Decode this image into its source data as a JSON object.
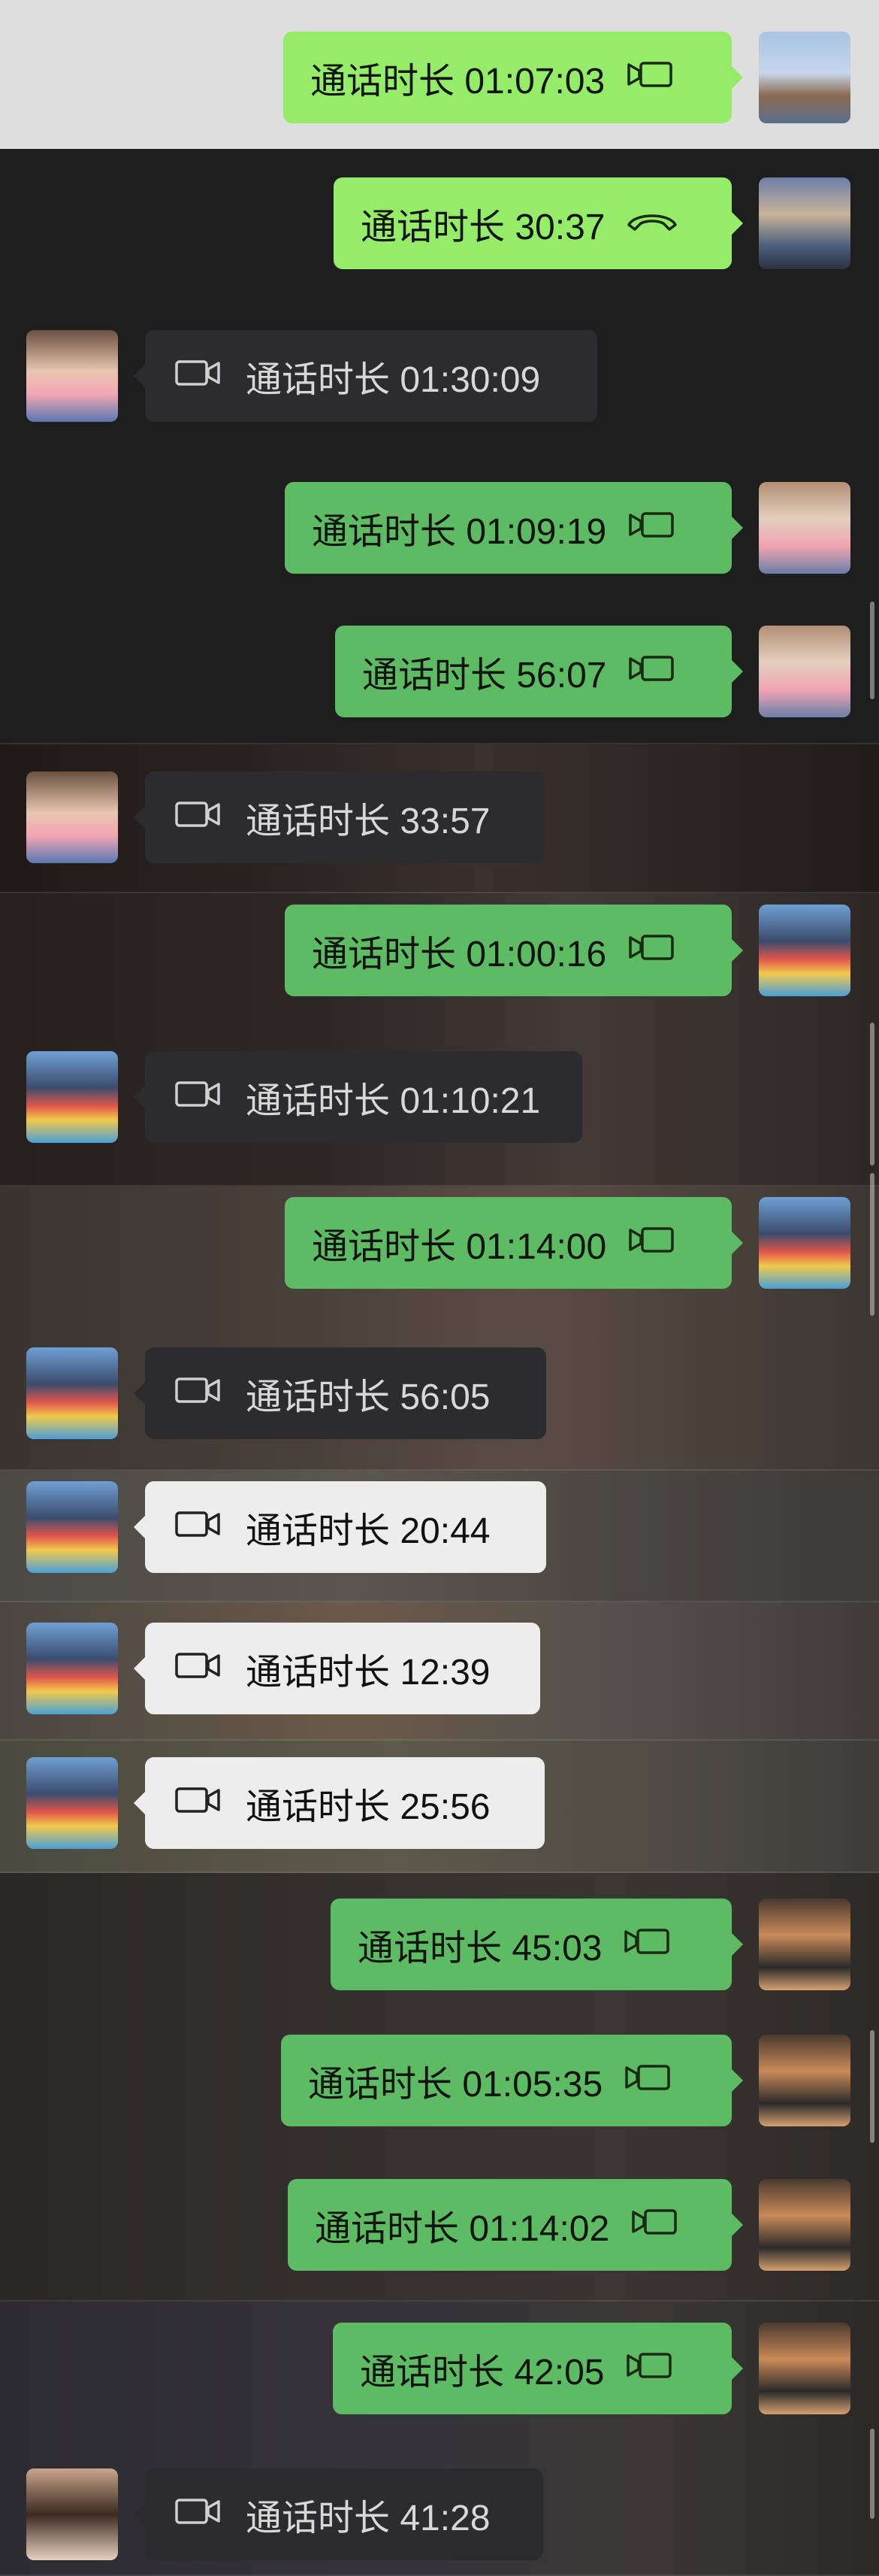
{
  "call_prefix": "通话时长",
  "messages": [
    {
      "side": "sent",
      "duration": "01:07:03",
      "icon": "video-call-icon",
      "style": "light"
    },
    {
      "side": "sent",
      "duration": "30:37",
      "icon": "voice-call-icon",
      "style": "light"
    },
    {
      "side": "received",
      "duration": "01:30:09",
      "icon": "video-call-icon",
      "style": "dark"
    },
    {
      "side": "sent",
      "duration": "01:09:19",
      "icon": "video-call-icon",
      "style": "dark"
    },
    {
      "side": "sent",
      "duration": "56:07",
      "icon": "video-call-icon",
      "style": "dark"
    },
    {
      "side": "received",
      "duration": "33:57",
      "icon": "video-call-icon",
      "style": "dark"
    },
    {
      "side": "sent",
      "duration": "01:00:16",
      "icon": "video-call-icon",
      "style": "dark"
    },
    {
      "side": "received",
      "duration": "01:10:21",
      "icon": "video-call-icon",
      "style": "dark"
    },
    {
      "side": "sent",
      "duration": "01:14:00",
      "icon": "video-call-icon",
      "style": "dark"
    },
    {
      "side": "received",
      "duration": "56:05",
      "icon": "video-call-icon",
      "style": "dark"
    },
    {
      "side": "received",
      "duration": "20:44",
      "icon": "video-call-icon",
      "style": "white"
    },
    {
      "side": "received",
      "duration": "12:39",
      "icon": "video-call-icon",
      "style": "white"
    },
    {
      "side": "received",
      "duration": "25:56",
      "icon": "video-call-icon",
      "style": "white"
    },
    {
      "side": "sent",
      "duration": "45:03",
      "icon": "video-call-icon",
      "style": "dark"
    },
    {
      "side": "sent",
      "duration": "01:05:35",
      "icon": "video-call-icon",
      "style": "dark"
    },
    {
      "side": "sent",
      "duration": "01:14:02",
      "icon": "video-call-icon",
      "style": "dark"
    },
    {
      "side": "sent",
      "duration": "42:05",
      "icon": "video-call-icon",
      "style": "dark"
    },
    {
      "side": "received",
      "duration": "41:28",
      "icon": "video-call-icon",
      "style": "dark"
    }
  ],
  "colors": {
    "sent_bubble_light": "#95ec69",
    "sent_bubble": "#5dbb63",
    "received_bubble": "#2c2c2e",
    "received_bubble_white": "#ededed",
    "light_background": "#dedede",
    "dark_background": "#1d1d1f"
  }
}
